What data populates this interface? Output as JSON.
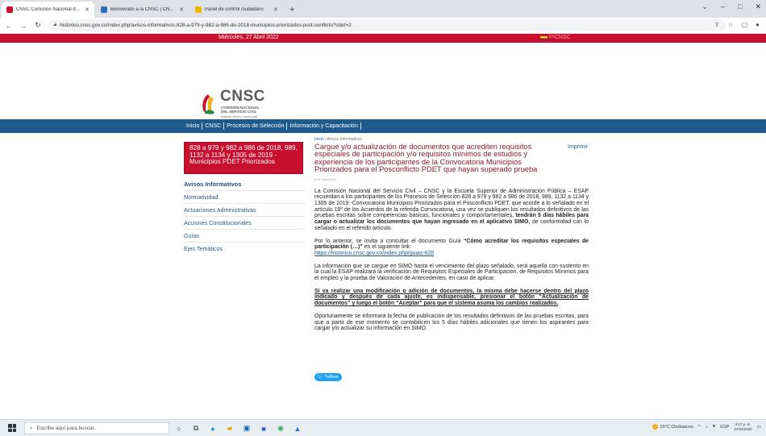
{
  "browser": {
    "tabs": [
      {
        "label": "CNSC Comisión Nacional del Se",
        "favicon_color": "#c8102e",
        "active": true
      },
      {
        "label": "Bienvenido a la CNSC | CNSC",
        "favicon_color": "#2a6ebb",
        "active": false
      },
      {
        "label": "Panel de control ciudadano",
        "favicon_color": "#f0b400",
        "active": false
      }
    ],
    "new_tab": "+",
    "url": "historico.cnsc.gov.co/index.php/avisos-informativos-828-a-979-y-982-a-986-de-2018-municipios-priorizados-post-conflicto?start=2"
  },
  "page": {
    "date": "Miércoles, 27 Abril 2022",
    "top_right": "CNSC",
    "top_right_small": "ES",
    "logo": {
      "title": "CNSC",
      "subtitle_line1": "COMISIÓN NACIONAL",
      "subtitle_line2": "DEL SERVICIO CIVIL",
      "tagline": "Igualdad, Mérito y Oportunidad"
    },
    "nav": [
      "Inicio",
      "CNSC",
      "Procesos de Selección",
      "Información y Capacitación"
    ],
    "sidebar": {
      "box": "828 a 979 y 982 a 986 de 2018, 989, 1132 a 1134 y 1305 de 2019 - Municipios PDET Priorizados",
      "heading": "Avisos Informativos",
      "items": [
        "Normatividad",
        "Actuaciones Administrativas",
        "Acciones Constitucionales",
        "Guías",
        "Ejes Temáticos"
      ]
    },
    "breadcrumb": {
      "home": "Inicio",
      "sep": "/",
      "current": "Avisos Informativos"
    },
    "article": {
      "title": "Cargue y/o actualización de documentos que acrediten requisitos especiales de participación y/o requisitos mínimos de estudios y experiencia de los participantes de la Convocatoria Municipios Priorizados para el Posconflicto PDET que hayan superado prueba",
      "print": "Imprimir",
      "date_small": "el 21 Marzo 2022",
      "p1_a": "La Comisión Nacional del Servicio Civil – CNSC y la Escuela Superior de Administración Pública – ESAP recuerdan a los participantes de los Procesos de Selección 828 a 979 y 982 a 986 de 2018, 989, 1132 a 1134 y 1305 de 2019 -Convocatoria Municipios Priorizados para el Posconflicto PDET, que acorde a lo señalado en el artículo 18º de los Acuerdos de la referida Convocatoria, una vez se publiquen los resultados definitivos de las pruebas escritas sobre competencias básicas, funcionales y comportamentales,",
      "p1_bold": "tendrán 5 días hábiles para cargar o actualizar los documentos que hayan ingresado en el aplicativo SIMO",
      "p1_b": ", de conformidad con lo señalado en el referido artículo.",
      "p2_a": "Por lo anterior, se invita a consultar el documento Guía",
      "p2_bold": "“Cómo acreditar los requisitos especiales de participación (…)”",
      "p2_b": "en el siguiente link:",
      "p2_link": "https://historico.cnsc.gov.co/index.php/guias-828",
      "p3": "La información que se cargue en SIMO hasta el vencimiento del plazo señalado, será aquella con sustento en la cual la ESAP realizará la verificación de Requisitos Especiales de Participación, de Requisitos Mínimos para el empleo y la prueba de Valoración de Antecedentes, en caso de aplicar.",
      "p4": "Si va realizar una modificación o adición de documentos, la misma debe hacerse dentro del plazo indicado y después de cada ajuste, es indispensable, presionar el botón “Actualización de documentos” y luego el botón “Aceptar” para que el sistema asuma los cambios realizados.",
      "p5": "Oportunamente se informará la fecha de publicación de los resultados definitivos de las pruebas escritas, para que a partir de ese momento se contabilicen los 5 días hábiles adicionales que tienen los aspirantes para cargar y/o actualizar su información en SIMO."
    },
    "twitter": "Twittear"
  },
  "taskbar": {
    "search_placeholder": "Escribe aquí para buscar.",
    "weather": "29°C Chubascos",
    "lang": "ESP",
    "time": "4:17 p. m.",
    "date": "27/04/2022"
  }
}
